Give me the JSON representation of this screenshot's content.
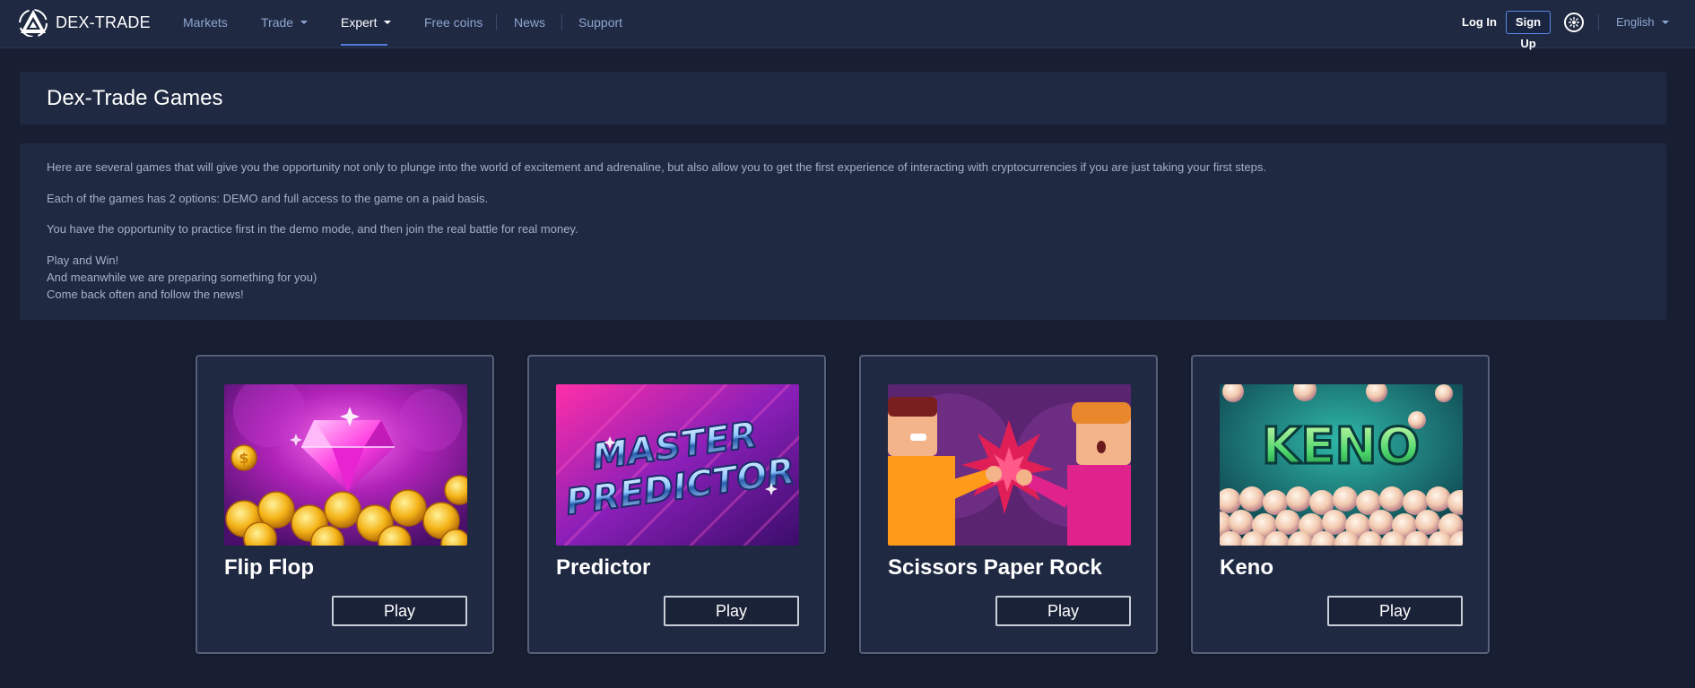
{
  "brand": {
    "name": "DEX-TRADE"
  },
  "nav": {
    "markets": "Markets",
    "trade": "Trade",
    "expert": "Expert",
    "free_coins": "Free coins",
    "news": "News",
    "support": "Support"
  },
  "auth": {
    "login": "Log In",
    "signup": "Sign Up"
  },
  "language": "English",
  "page": {
    "title": "Dex-Trade Games"
  },
  "intro": {
    "p1": "Here are several games that will give you the opportunity not only to plunge into the world of excitement and adrenaline, but also allow you to get the first experience of interacting with cryptocurrencies if you are just taking your first steps.",
    "p2": "Each of the games has 2 options: DEMO and full access to the game on a paid basis.",
    "p3": "You have the opportunity to practice first in the demo mode, and then join the real battle for real money.",
    "p4": "Play and Win!",
    "p5": "And meanwhile we are preparing something for you)",
    "p6": "Come back often and follow the news!"
  },
  "games": [
    {
      "title": "Flip Flop",
      "play_label": "Play"
    },
    {
      "title": "Predictor",
      "play_label": "Play"
    },
    {
      "title": "Scissors Paper Rock",
      "play_label": "Play"
    },
    {
      "title": "Keno",
      "play_label": "Play"
    }
  ],
  "image_text": {
    "predictor_line1": "MASTER",
    "predictor_line2": "PREDICTOR",
    "keno": "KENO",
    "coin_symbol": "$"
  },
  "icons": {
    "logo": "dex-trade-logo-icon",
    "theme": "theme-toggle-icon",
    "dropdown": "chevron-down-icon"
  },
  "colors": {
    "page_bg": "#181f33",
    "panel_bg": "#1f2942",
    "nav_link": "#8fa5d1",
    "accent": "#4f7bd6",
    "card_border": "#55607a"
  }
}
